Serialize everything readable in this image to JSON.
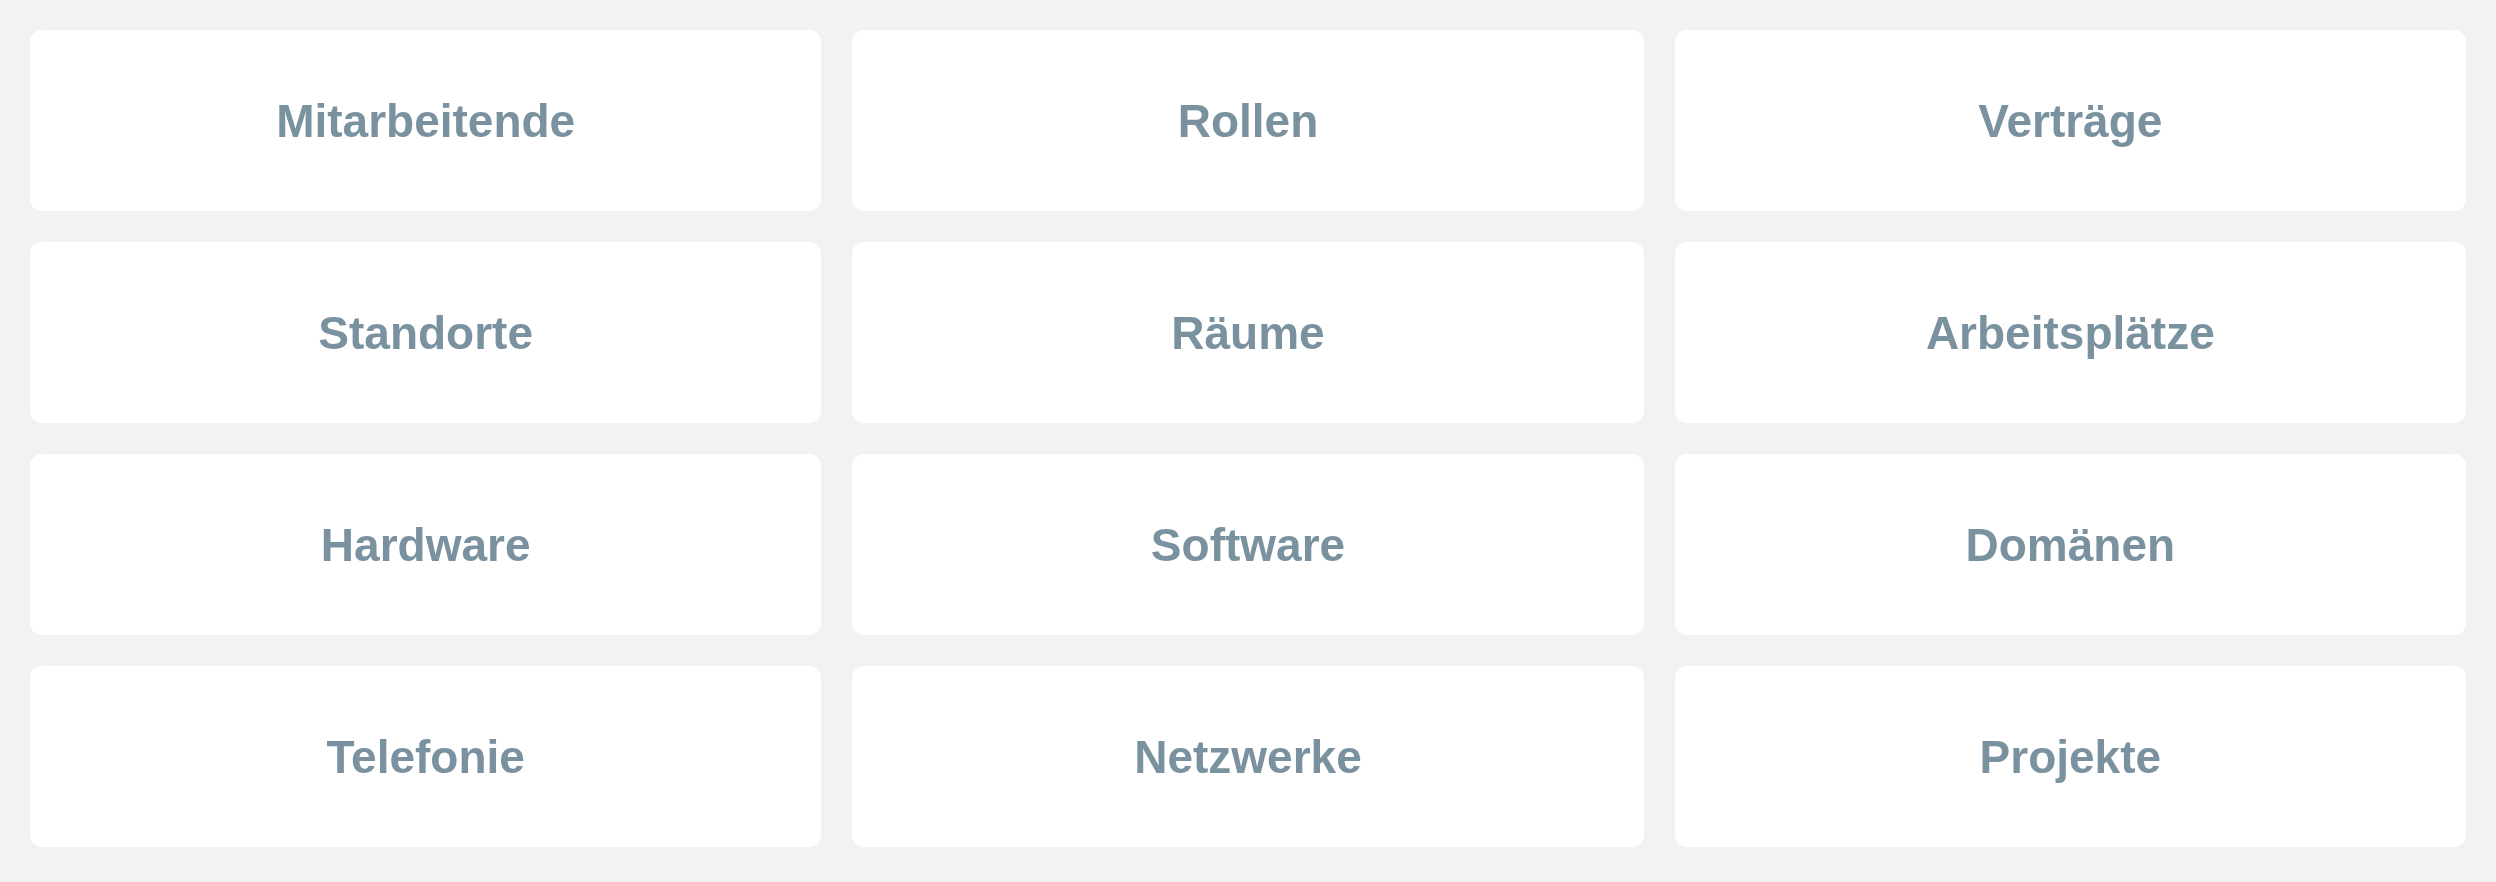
{
  "tiles": [
    {
      "label": "Mitarbeitende"
    },
    {
      "label": "Rollen"
    },
    {
      "label": "Verträge"
    },
    {
      "label": "Standorte"
    },
    {
      "label": "Räume"
    },
    {
      "label": "Arbeitsplätze"
    },
    {
      "label": "Hardware"
    },
    {
      "label": "Software"
    },
    {
      "label": "Domänen"
    },
    {
      "label": "Telefonie"
    },
    {
      "label": "Netzwerke"
    },
    {
      "label": "Projekte"
    }
  ]
}
